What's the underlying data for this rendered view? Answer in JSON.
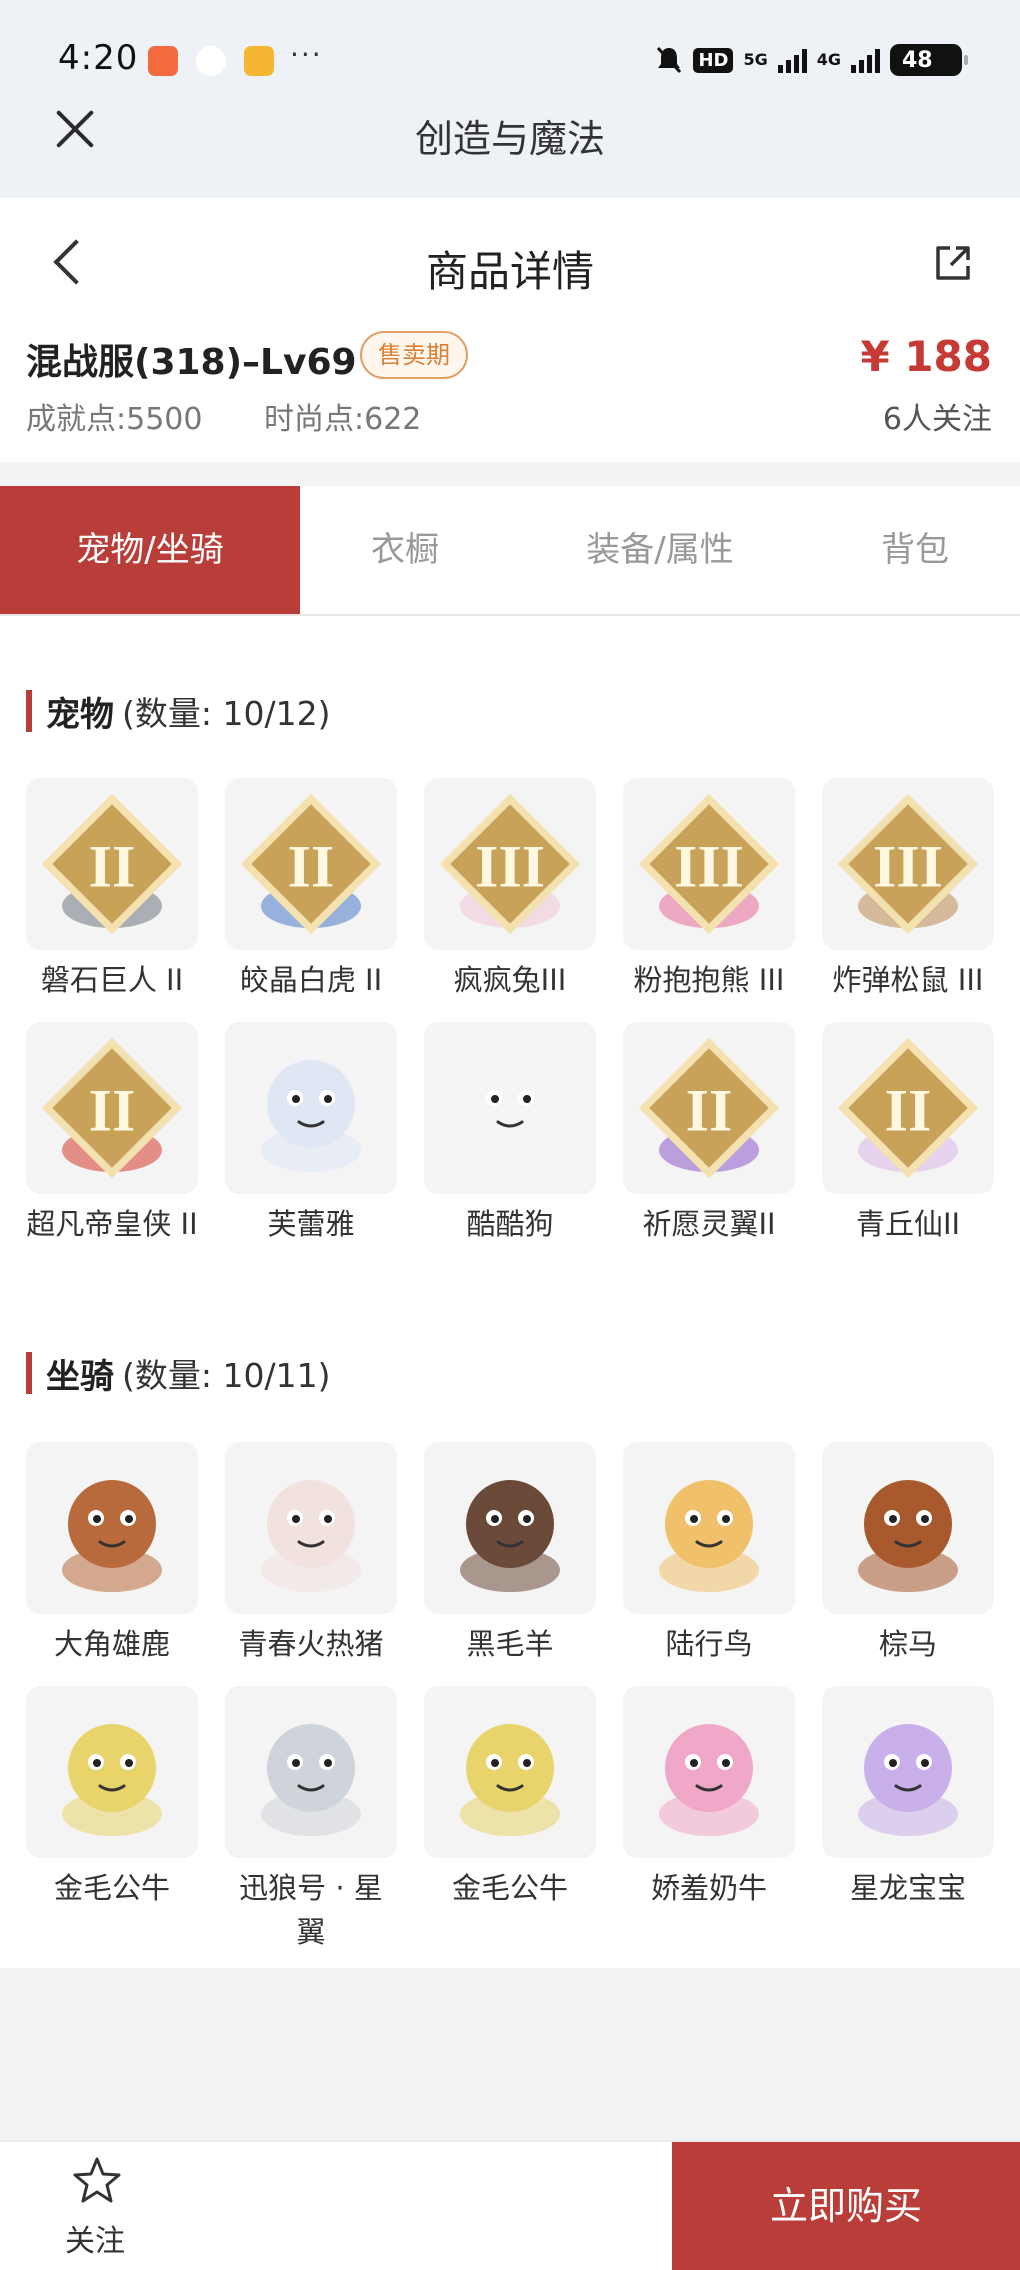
{
  "status_bar": {
    "time": "4:20",
    "icons": [
      "taobao-app-icon",
      "fruit-app-icon",
      "grid-app-icon",
      "more-dots-icon",
      "mute-icon",
      "hd-icon",
      "5g-signal-icon",
      "4g-signal-icon",
      "battery-icon"
    ],
    "hd_label": "HD",
    "net_5g": "5G",
    "net_4g": "4G",
    "battery": "48",
    "dots": "···"
  },
  "app_bar": {
    "title": "创造与魔法"
  },
  "page_header": {
    "title": "商品详情"
  },
  "product": {
    "name": "混战服(318)–Lv69",
    "badge": "售卖期",
    "achievement": "成就点:5500",
    "fashion": "时尚点:622",
    "price": "¥ 188",
    "followers": "6人关注"
  },
  "tabs": [
    {
      "label": "宠物/坐骑",
      "active": true
    },
    {
      "label": "衣橱",
      "active": false
    },
    {
      "label": "装备/属性",
      "active": false
    },
    {
      "label": "背包",
      "active": false
    }
  ],
  "pets": {
    "title": "宠物",
    "count": "(数量: 10/12)",
    "items": [
      {
        "label": "磐石巨人 II",
        "tier": "II",
        "icon": "stone-giant-icon",
        "color": "#6f7480"
      },
      {
        "label": "皎晶白虎 II",
        "tier": "II",
        "icon": "white-tiger-icon",
        "color": "#4b78c9"
      },
      {
        "label": "疯疯兔III",
        "tier": "III",
        "icon": "bunny-icon",
        "color": "#f3c6d6"
      },
      {
        "label": "粉抱抱熊 III",
        "tier": "III",
        "icon": "pink-bear-icon",
        "color": "#e86a9c"
      },
      {
        "label": "炸弹松鼠 III",
        "tier": "III",
        "icon": "squirrel-icon",
        "color": "#b98850"
      },
      {
        "label": "超凡帝皇侠 II",
        "tier": "II",
        "icon": "emperor-hero-icon",
        "color": "#d63b2b"
      },
      {
        "label": "芙蕾雅",
        "tier": "",
        "icon": "freya-icon",
        "color": "#dfe6f4"
      },
      {
        "label": "酷酷狗",
        "tier": "",
        "icon": "cool-dog-icon",
        "color": "#f5f5f5"
      },
      {
        "label": "祈愿灵翼II",
        "tier": "II",
        "icon": "wish-wing-bird-icon",
        "color": "#8a5ac8"
      },
      {
        "label": "青丘仙II",
        "tier": "II",
        "icon": "fox-fairy-icon",
        "color": "#d8b6e8"
      }
    ]
  },
  "mounts": {
    "title": "坐骑",
    "count": "(数量: 10/11)",
    "items": [
      {
        "label": "大角雄鹿",
        "tier": "",
        "icon": "stag-icon",
        "color": "#b86a3c"
      },
      {
        "label": "青春火热猪",
        "tier": "",
        "icon": "pig-icon",
        "color": "#f1e2e0"
      },
      {
        "label": "黑毛羊",
        "tier": "",
        "icon": "black-sheep-icon",
        "color": "#6b4a3a"
      },
      {
        "label": "陆行鸟",
        "tier": "",
        "icon": "ostrich-bird-icon",
        "color": "#f0c06a"
      },
      {
        "label": "棕马",
        "tier": "",
        "icon": "brown-horse-icon",
        "color": "#a85a2e"
      },
      {
        "label": "金毛公牛",
        "tier": "",
        "icon": "golden-bull-icon",
        "color": "#e8d46a"
      },
      {
        "label": "迅狼号 · 星翼",
        "tier": "",
        "icon": "mech-wolf-icon",
        "color": "#cfd4da"
      },
      {
        "label": "金毛公牛",
        "tier": "",
        "icon": "golden-bull-icon",
        "color": "#e8d46a"
      },
      {
        "label": "娇羞奶牛",
        "tier": "",
        "icon": "shy-cow-icon",
        "color": "#f0a8c8"
      },
      {
        "label": "星龙宝宝",
        "tier": "",
        "icon": "star-dragon-icon",
        "color": "#c9b0ea"
      }
    ]
  },
  "bottom_bar": {
    "follow_label": "关注",
    "buy_label": "立即购买"
  },
  "colors": {
    "accent": "#b93e3a",
    "price": "#c53a35",
    "badge": "#d98236"
  }
}
